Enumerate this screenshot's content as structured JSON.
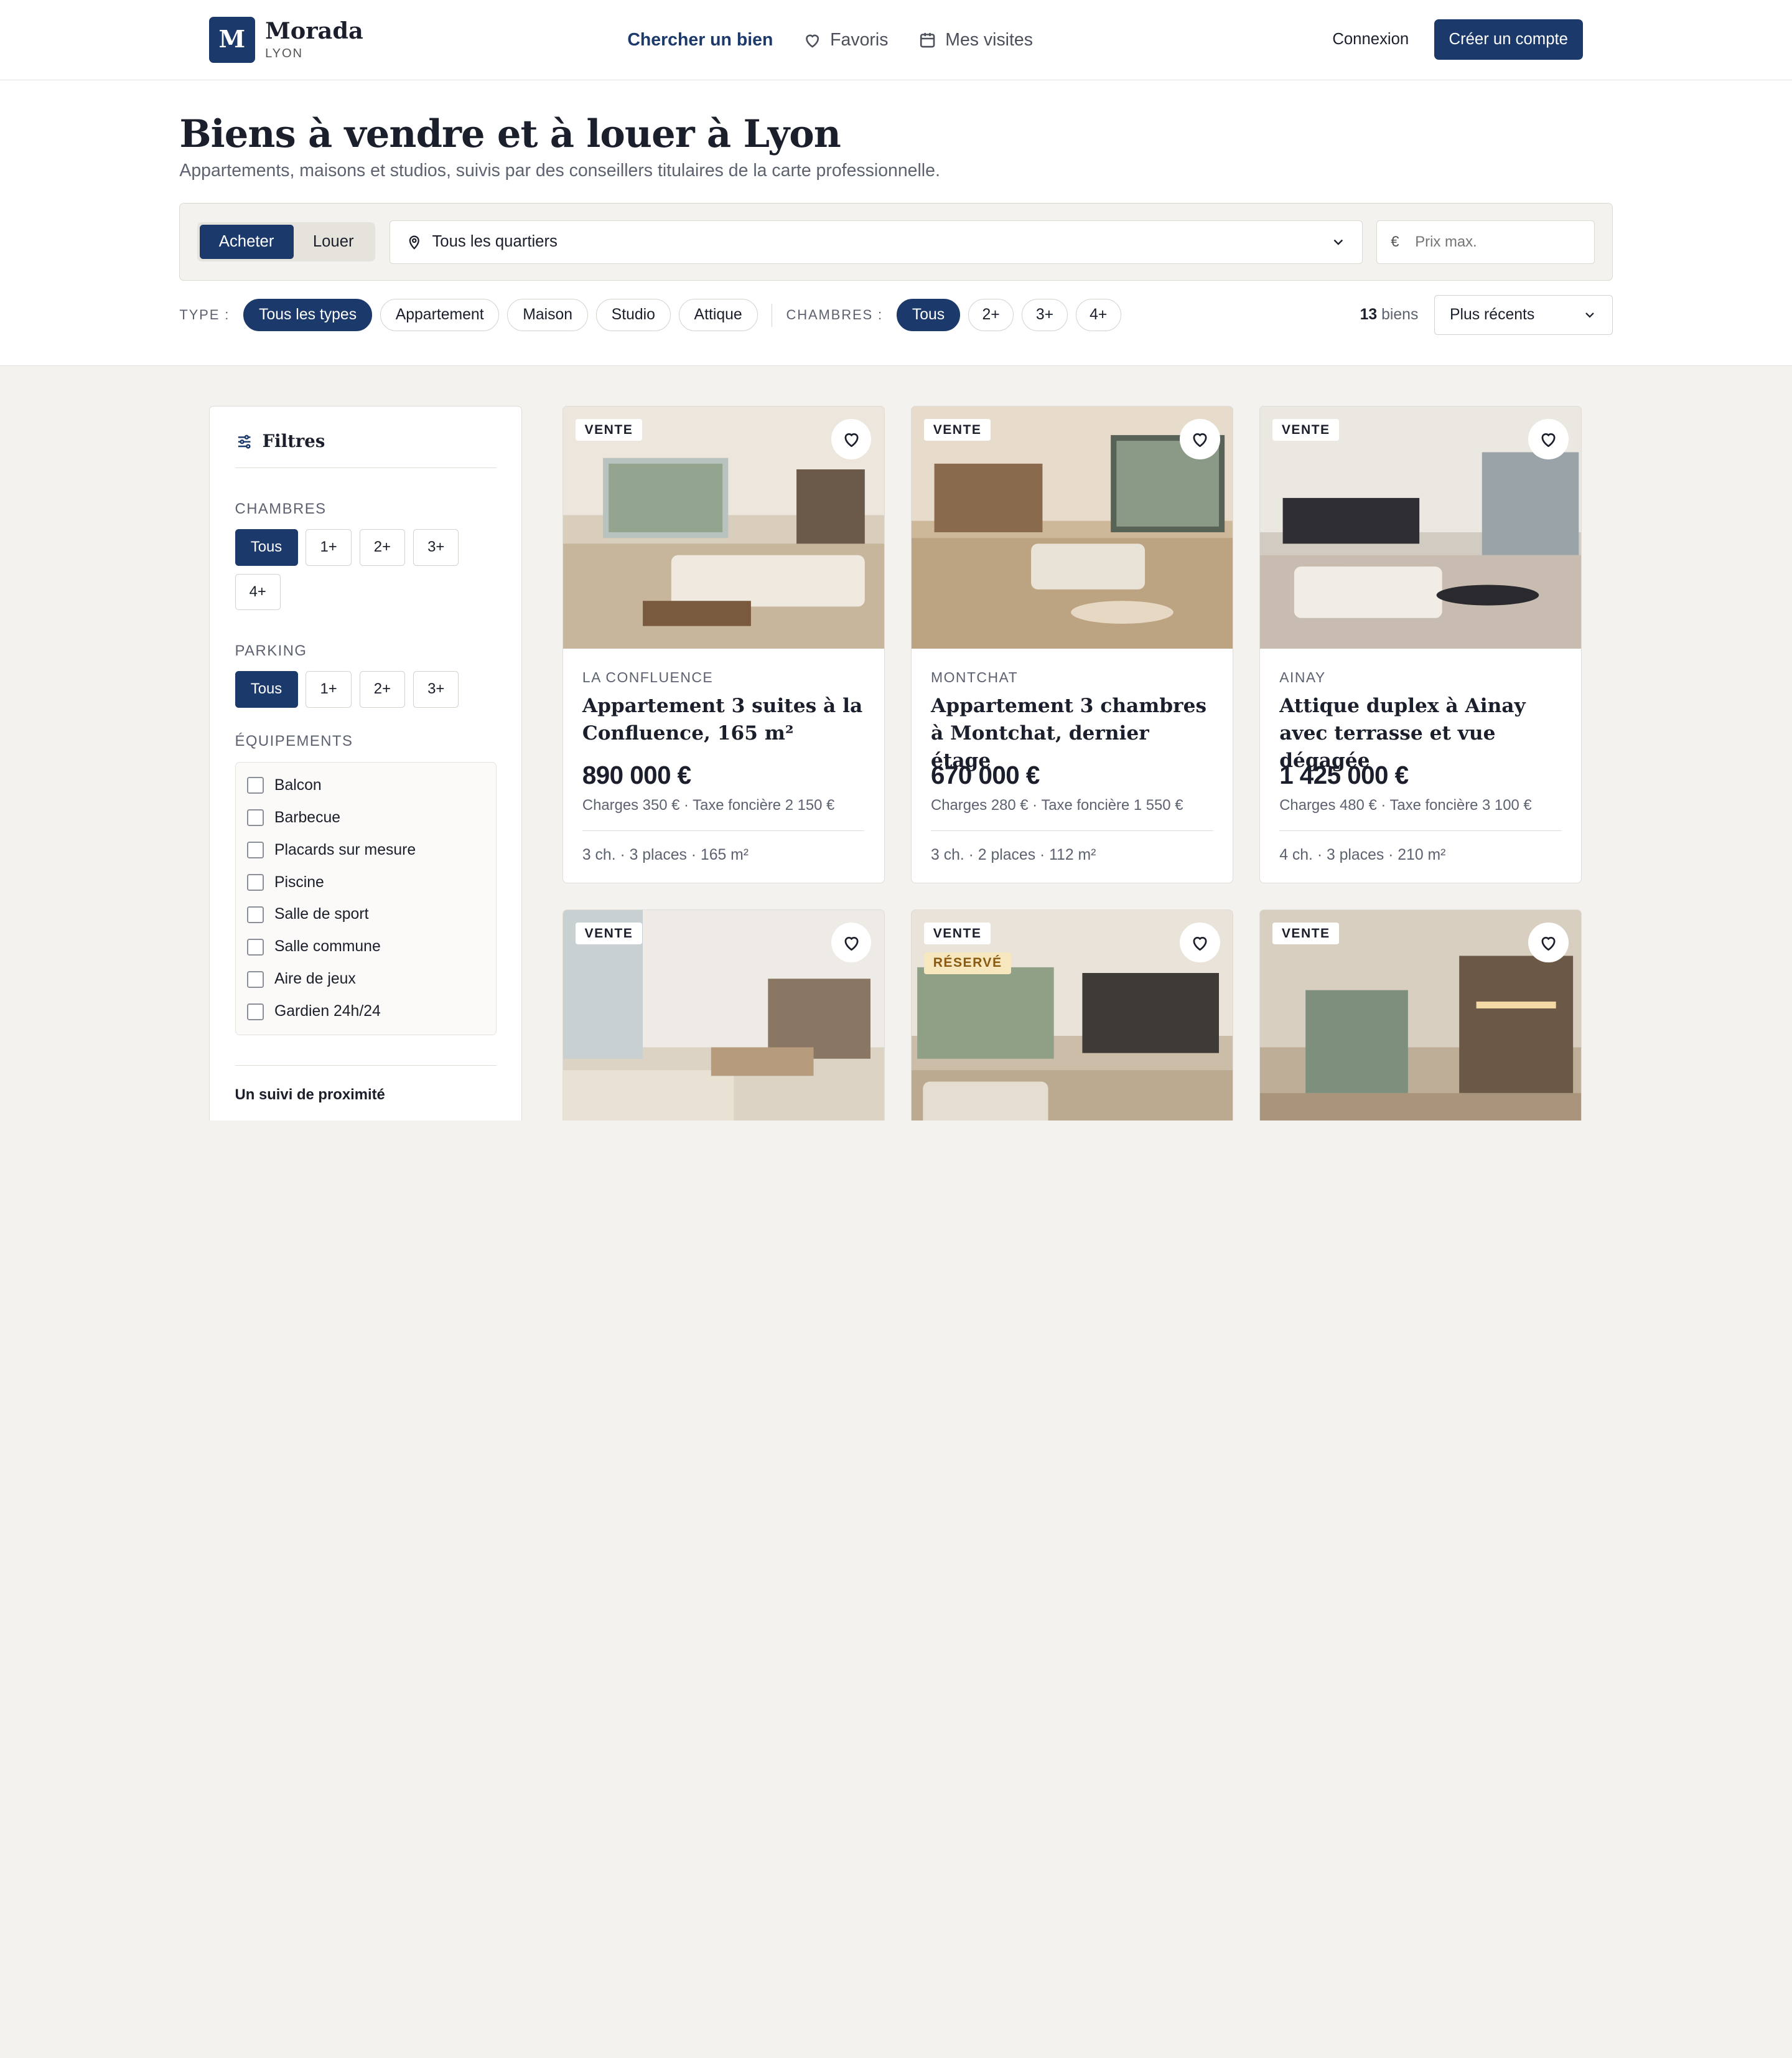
{
  "brand": {
    "mark": "M",
    "name": "Morada",
    "city": "LYON"
  },
  "nav": [
    {
      "label": "Chercher un bien",
      "icon": "none"
    },
    {
      "label": "Favoris",
      "icon": "heart-icon"
    },
    {
      "label": "Mes visites",
      "icon": "calendar-icon"
    }
  ],
  "auth": {
    "login": "Connexion",
    "signup": "Créer un compte"
  },
  "hero": {
    "title": "Biens à vendre et à louer à Lyon",
    "subtitle": "Appartements, maisons et studios, suivis par des conseillers titulaires de la carte professionnelle."
  },
  "search": {
    "mode_buy": "Acheter",
    "mode_rent": "Louer",
    "district": "Tous les quartiers",
    "currency": "€",
    "price_placeholder": "Prix max."
  },
  "filters": {
    "type_label": "TYPE :",
    "types": [
      "Tous les types",
      "Appartement",
      "Maison",
      "Studio",
      "Attique"
    ],
    "rooms_label": "CHAMBRES :",
    "rooms": [
      "Tous",
      "2+",
      "3+",
      "4+"
    ],
    "count_number": "13",
    "count_suffix": "biens",
    "sort": "Plus récents"
  },
  "sidebar": {
    "title": "Filtres",
    "bedrooms_label": "CHAMBRES",
    "bedrooms": [
      "Tous",
      "1+",
      "2+",
      "3+",
      "4+"
    ],
    "parking_label": "PARKING",
    "parking": [
      "Tous",
      "1+",
      "2+",
      "3+"
    ],
    "equipment_label": "ÉQUIPEMENTS",
    "equipment": [
      "Balcon",
      "Barbecue",
      "Placards sur mesure",
      "Piscine",
      "Salle de sport",
      "Salle commune",
      "Aire de jeux",
      "Gardien 24h/24"
    ],
    "footer": "Un suivi de proximité"
  },
  "listings": [
    {
      "badge": "VENTE",
      "location": "LA CONFLUENCE",
      "title": "Appartement 3 suites à la Confluence, 165 m²",
      "price": "890 000 €",
      "charges": "Charges 350 € · Taxe foncière 2 150 €",
      "specs": "3 ch. · 3 places · 165 m²"
    },
    {
      "badge": "VENTE",
      "location": "MONTCHAT",
      "title": "Appartement 3 chambres à Montchat, dernier étage",
      "price": "670 000 €",
      "charges": "Charges 280 € · Taxe foncière 1 550 €",
      "specs": "3 ch. · 2 places · 112 m²"
    },
    {
      "badge": "VENTE",
      "location": "AINAY",
      "title": "Attique duplex à Ainay avec terrasse et vue dégagée",
      "price": "1 425 000 €",
      "charges": "Charges 480 € · Taxe foncière 3 100 €",
      "specs": "4 ch. · 3 places · 210 m²"
    },
    {
      "badge": "VENTE"
    },
    {
      "badge": "VENTE",
      "badge2": "RÉSERVÉ"
    },
    {
      "badge": "VENTE"
    }
  ],
  "colors": {
    "primary": "#1b3a6b",
    "background": "#f4f2ee",
    "reserved_bg": "#f6e7bf"
  }
}
